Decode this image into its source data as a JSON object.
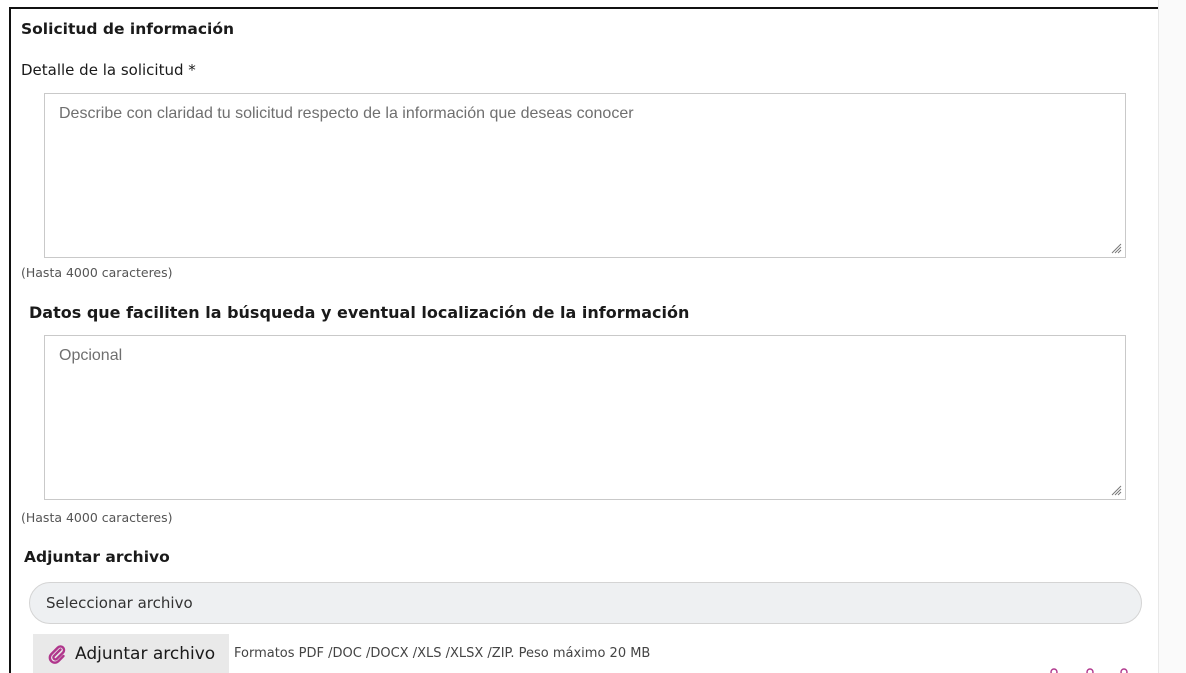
{
  "section": {
    "title": "Solicitud de información"
  },
  "detail": {
    "label": "Detalle de la solicitud *",
    "placeholder": "Describe con claridad tu solicitud respecto de la información que deseas conocer",
    "value": "",
    "hint": "(Hasta 4000 caracteres)"
  },
  "search_data": {
    "label": "Datos que faciliten la búsqueda y eventual localización de la información",
    "placeholder": "Opcional",
    "value": "",
    "hint": "(Hasta 4000 caracteres)"
  },
  "attachment": {
    "heading": "Adjuntar archivo",
    "file_placeholder": "Seleccionar archivo",
    "button_label": "Adjuntar archivo",
    "button_icon": "paperclip-icon",
    "formats_text": "Formatos PDF /DOC /DOCX /XLS /XLSX /ZIP. Peso máximo 20 MB"
  },
  "colors": {
    "accent_icon": "#b0368c",
    "button_bg": "#e9e9e9",
    "pill_bg": "#eef0f2"
  }
}
